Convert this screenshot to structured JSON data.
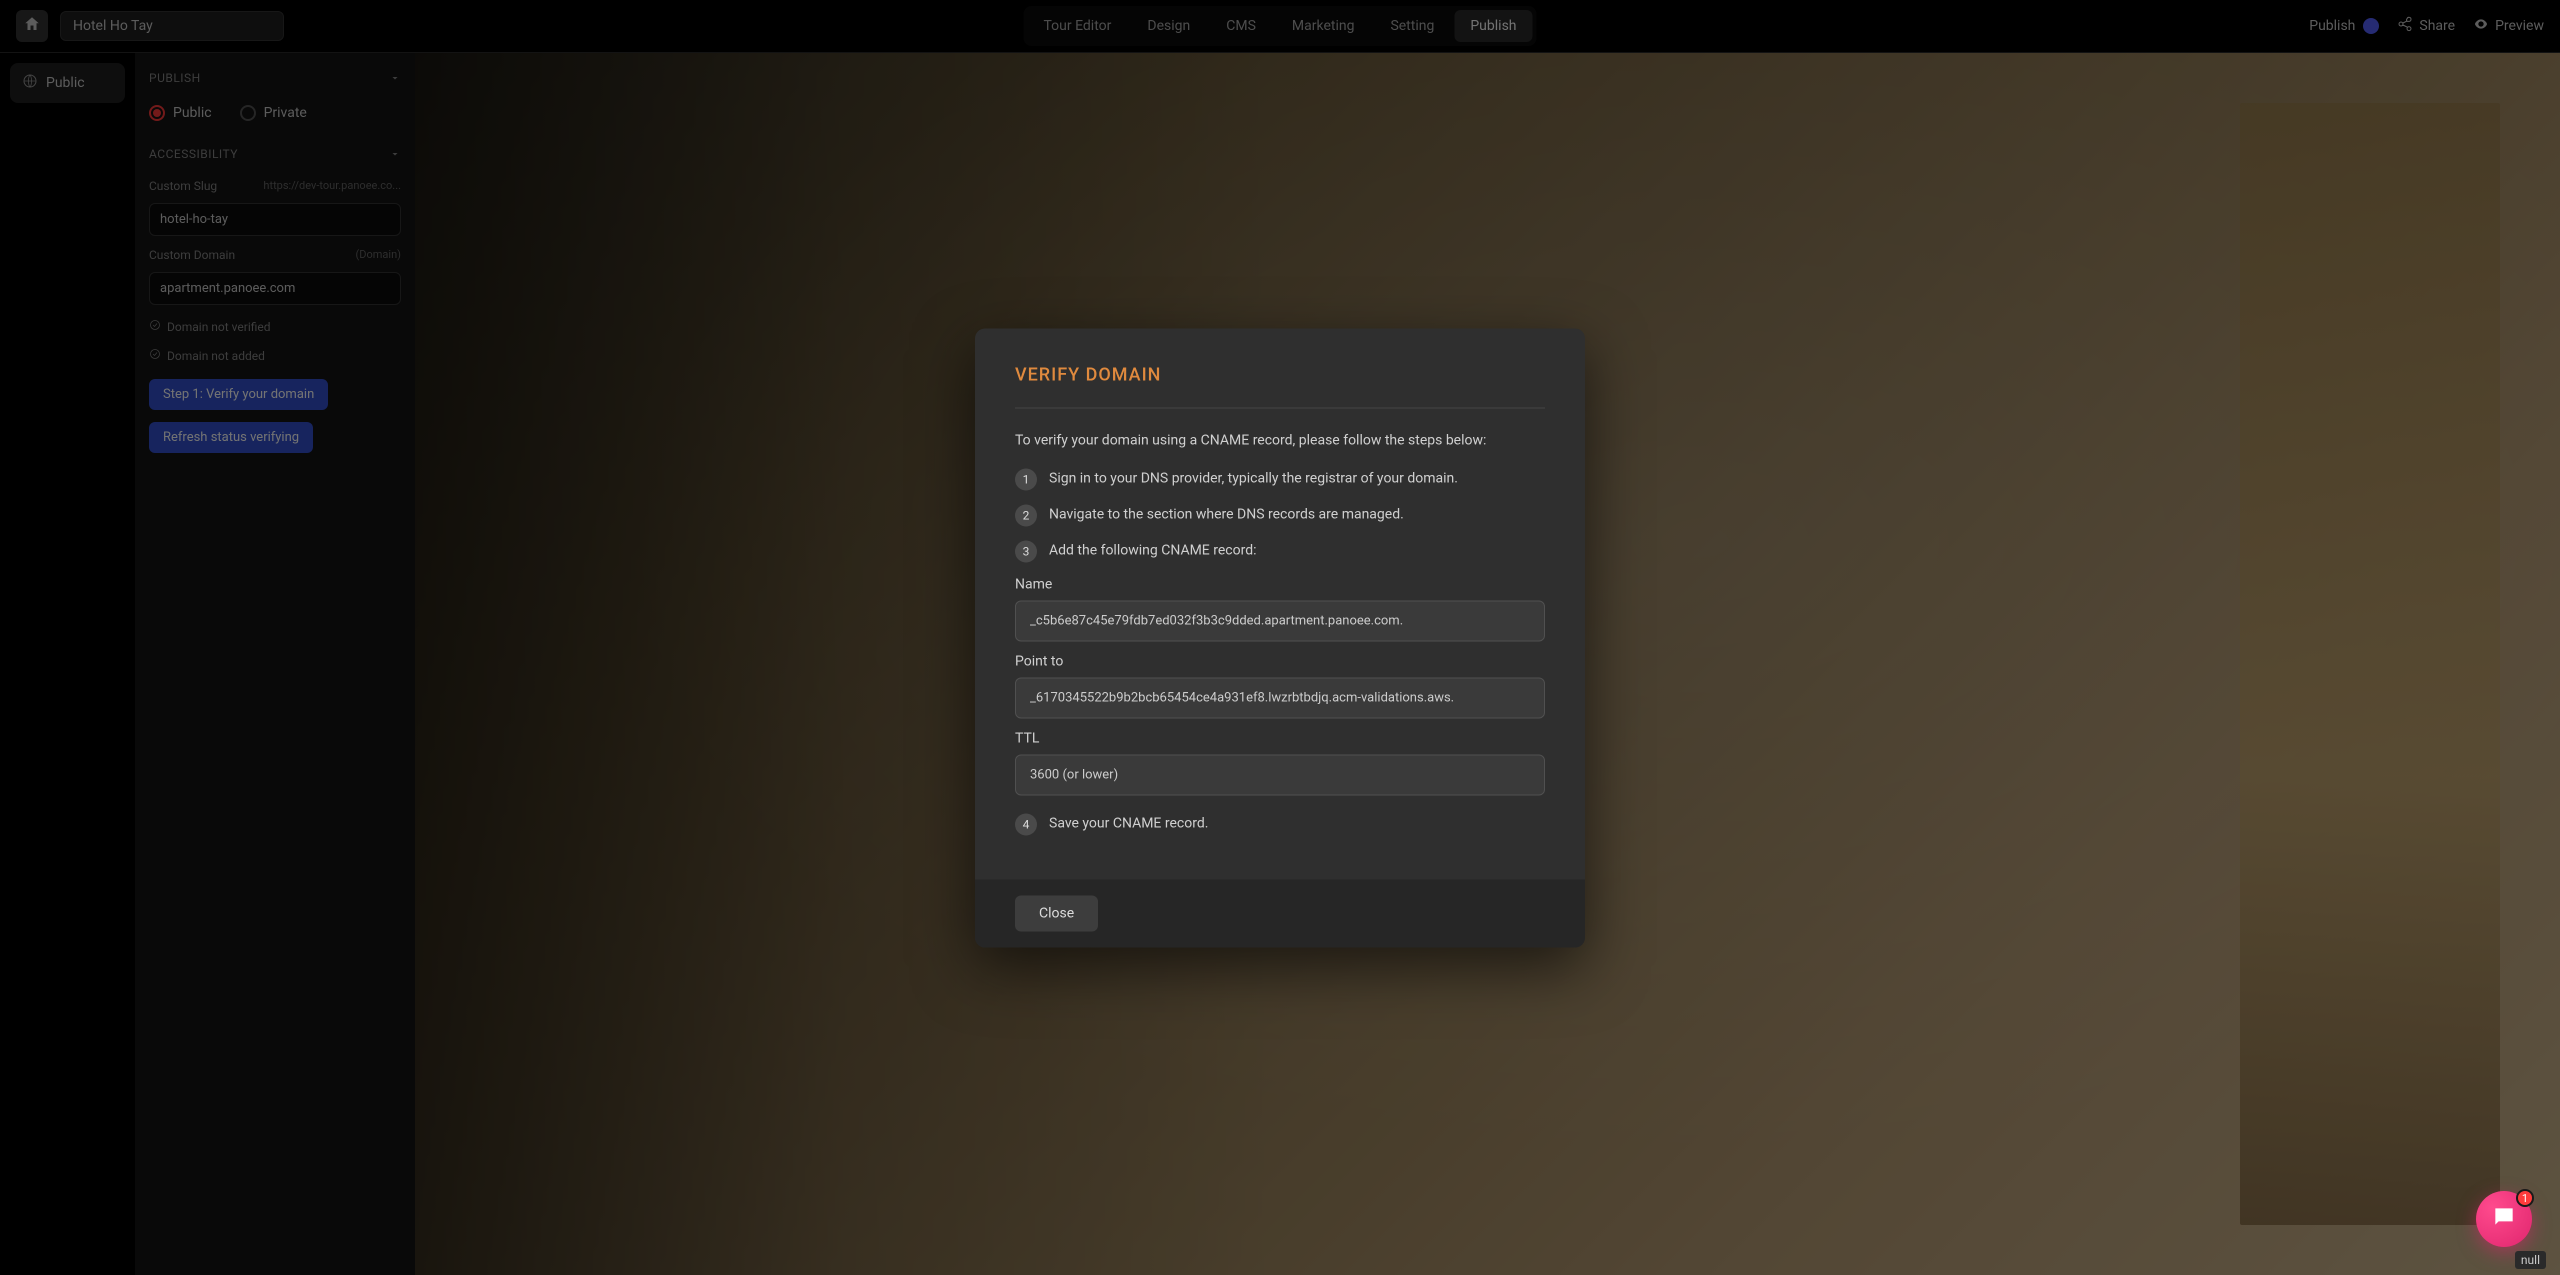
{
  "topbar": {
    "project_name": "Hotel Ho Tay",
    "tabs": [
      {
        "label": "Tour Editor"
      },
      {
        "label": "Design"
      },
      {
        "label": "CMS"
      },
      {
        "label": "Marketing"
      },
      {
        "label": "Setting"
      },
      {
        "label": "Publish"
      }
    ],
    "publish_status_label": "Publish",
    "share_label": "Share",
    "preview_label": "Preview"
  },
  "left_rail": {
    "item_label": "Public"
  },
  "settings": {
    "publish_header": "PUBLISH",
    "visibility": {
      "public_label": "Public",
      "private_label": "Private",
      "selected": "public"
    },
    "accessibility_header": "ACCESSIBILITY",
    "custom_slug": {
      "label": "Custom Slug",
      "hint": "https://dev-tour.panoee.co...",
      "value": "hotel-ho-tay"
    },
    "custom_domain": {
      "label": "Custom Domain",
      "hint": "(Domain)",
      "value": "apartment.panoee.com"
    },
    "status_not_verified": "Domain not verified",
    "status_not_added": "Domain not added",
    "verify_button": "Step 1:  Verify your domain",
    "refresh_button": "Refresh status verifying"
  },
  "modal": {
    "title": "VERIFY DOMAIN",
    "intro": "To verify your domain using a CNAME record, please follow the steps below:",
    "steps": [
      "Sign in to your DNS provider, typically the registrar of your domain.",
      "Navigate to the section where DNS records are managed.",
      "Add the following CNAME record:",
      "Save your CNAME record."
    ],
    "fields": {
      "name_label": "Name",
      "name_value": "_c5b6e87c45e79fdb7ed032f3b3c9dded.apartment.panoee.com.",
      "point_label": "Point to",
      "point_value": "_6170345522b9b2bcb65454ce4a931ef8.lwzrbtbdjq.acm-validations.aws.",
      "ttl_label": "TTL",
      "ttl_value": "3600 (or lower)"
    },
    "close_label": "Close"
  },
  "chat": {
    "badge_count": "1"
  },
  "tooltip": {
    "text": "null"
  }
}
